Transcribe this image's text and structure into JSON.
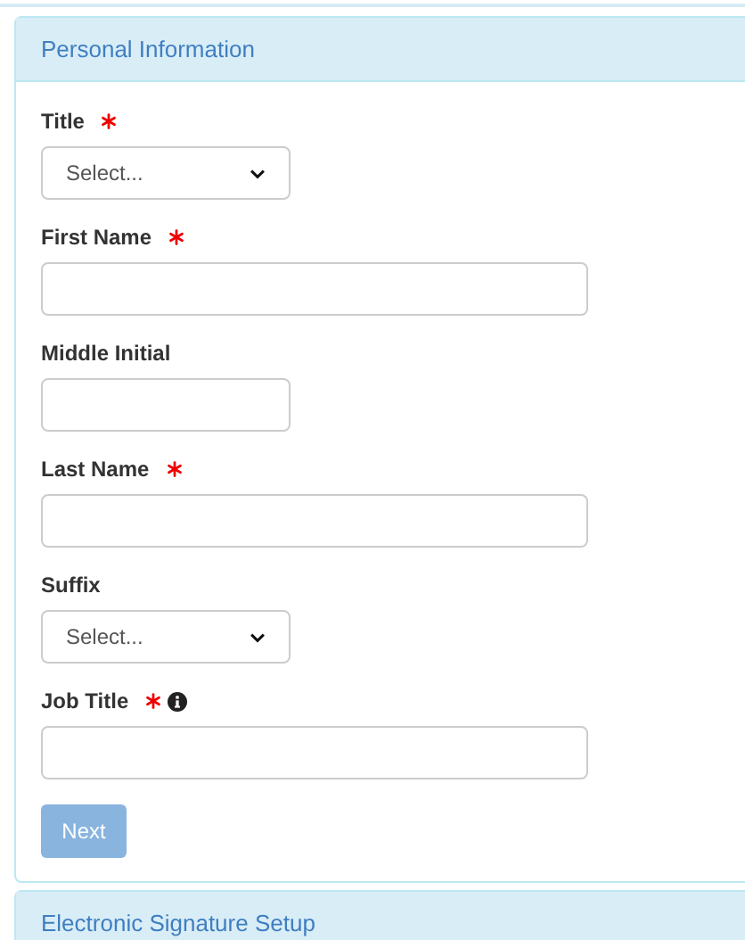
{
  "panels": [
    {
      "title": "Personal Information",
      "expanded": true,
      "fields": [
        {
          "label": "Title",
          "kind": "select",
          "required": true,
          "info": false,
          "placeholder": "Select..."
        },
        {
          "label": "First Name",
          "kind": "text",
          "required": true,
          "info": false
        },
        {
          "label": "Middle Initial",
          "kind": "short_text",
          "required": false,
          "info": false
        },
        {
          "label": "Last Name",
          "kind": "text",
          "required": true,
          "info": false
        },
        {
          "label": "Suffix",
          "kind": "select",
          "required": false,
          "info": false,
          "placeholder": "Select..."
        },
        {
          "label": "Job Title",
          "kind": "text",
          "required": true,
          "info": true
        }
      ],
      "button": {
        "label": "Next",
        "disabled": true
      }
    },
    {
      "title": "Electronic Signature Setup",
      "expanded": false
    }
  ]
}
